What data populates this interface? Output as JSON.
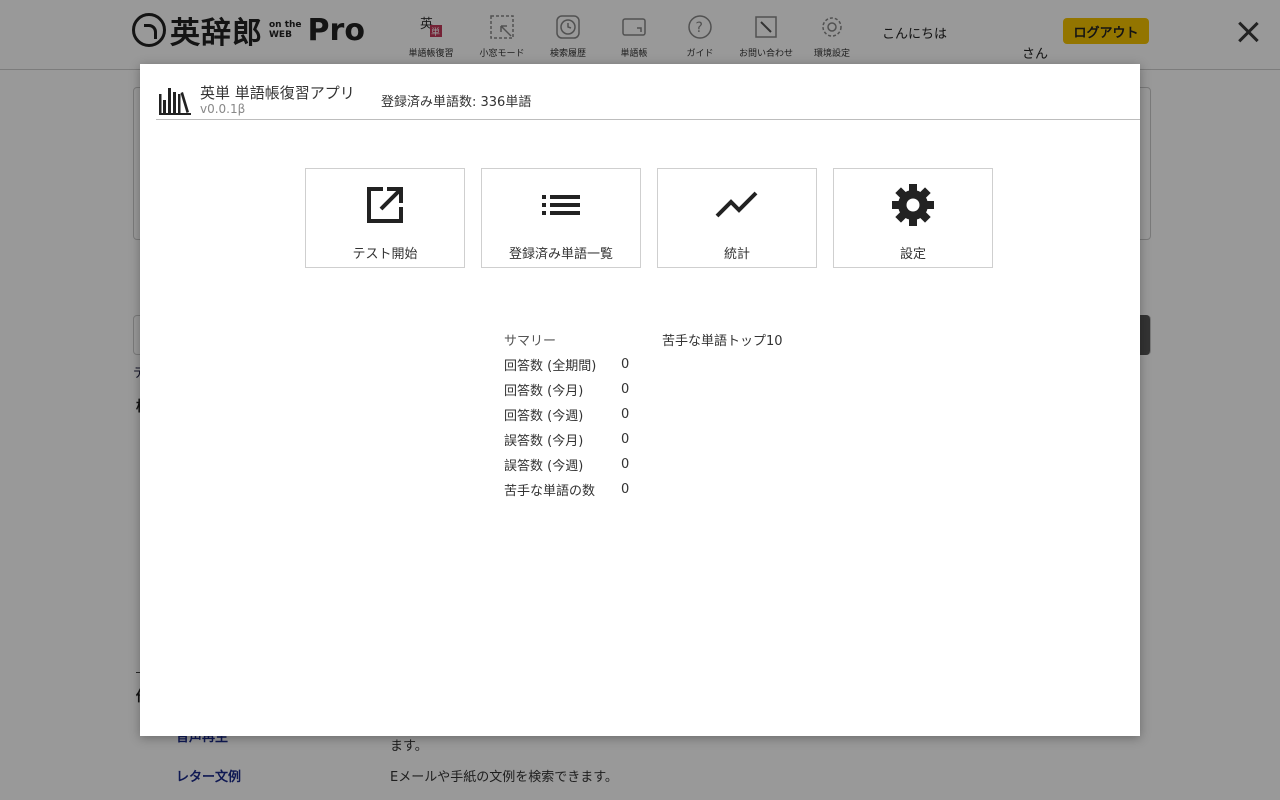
{
  "header": {
    "logo_main": "英辞郎",
    "logo_sub_top": "on the",
    "logo_sub_bottom": "WEB",
    "logo_pro": "Pro",
    "nav": [
      {
        "label": "単語帳復習",
        "icon": "vocab-review-icon"
      },
      {
        "label": "小窓モード",
        "icon": "small-window-icon"
      },
      {
        "label": "検索履歴",
        "icon": "clock-icon"
      },
      {
        "label": "単語帳",
        "icon": "wordbook-icon"
      },
      {
        "label": "ガイド",
        "icon": "help-icon"
      },
      {
        "label": "お問い合わせ",
        "icon": "contact-icon"
      },
      {
        "label": "環境設定",
        "icon": "gear-icon"
      }
    ],
    "greeting": "こんにちは",
    "greeting_suffix": "さん",
    "logout_label": "ログアウト"
  },
  "background": {
    "fragment_1": "デ",
    "fragment_2": "検",
    "fragment_3": "他",
    "rows": [
      {
        "label": "音声再生",
        "desc": "ます。"
      },
      {
        "label": "レター文例",
        "desc": "Eメールや手紙の文例を検索できます。"
      }
    ]
  },
  "modal": {
    "app_title": "英単 単語帳復習アプリ",
    "version": "v0.0.1β",
    "registered_count": "登録済み単語数: 336単語",
    "tiles": [
      {
        "label": "テスト開始",
        "icon": "open-external-icon"
      },
      {
        "label": "登録済み単語一覧",
        "icon": "list-icon"
      },
      {
        "label": "統計",
        "icon": "trend-line-icon"
      },
      {
        "label": "設定",
        "icon": "gear-icon"
      }
    ],
    "summary_title": "サマリー",
    "summary_rows": [
      {
        "label": "回答数 (全期間)",
        "value": "0"
      },
      {
        "label": "回答数 (今月)",
        "value": "0"
      },
      {
        "label": "回答数 (今週)",
        "value": "0"
      },
      {
        "label": "誤答数 (今月)",
        "value": "0"
      },
      {
        "label": "誤答数 (今週)",
        "value": "0"
      },
      {
        "label": "苦手な単語の数",
        "value": "0"
      }
    ],
    "weak_words_title": "苦手な単語トップ10"
  },
  "colors": {
    "logout_bg": "#f5c400",
    "overlay": "rgba(0,0,0,0.40)",
    "link": "#1a2a8a"
  }
}
